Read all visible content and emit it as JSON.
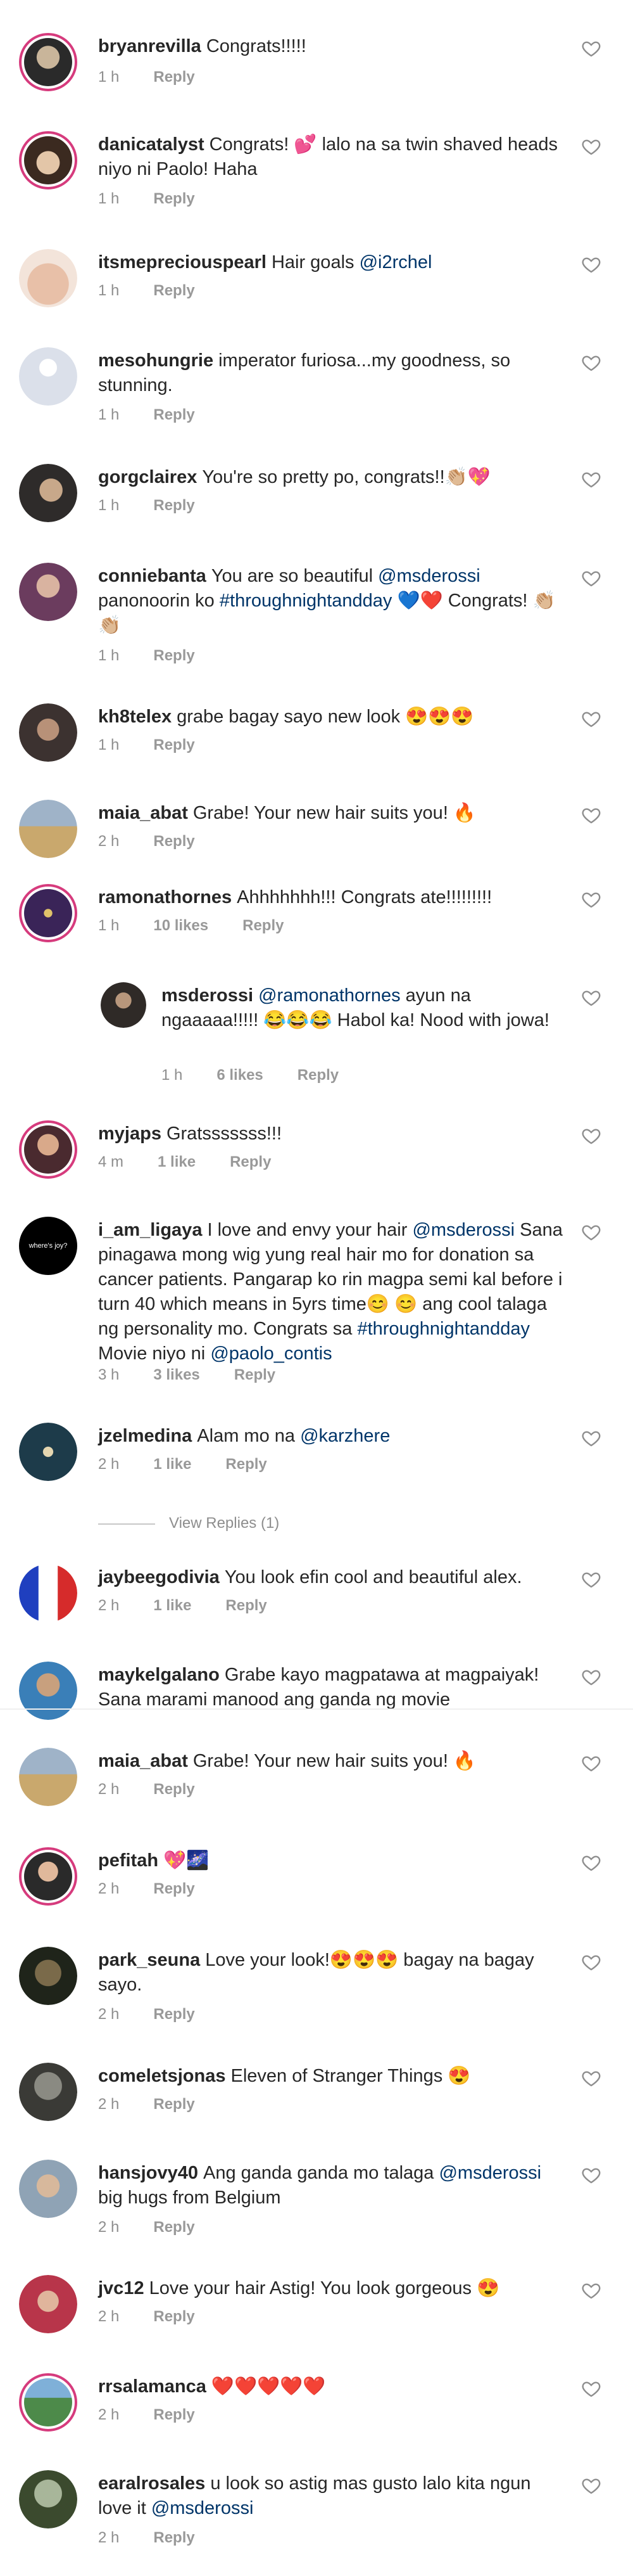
{
  "colors": {
    "link": "#003569",
    "meta": "#8e8e8e",
    "ring": "#d63b7d"
  },
  "comments": [
    {
      "user": "bryanrevilla",
      "text": "Congrats!!!!!",
      "time": "1 h",
      "likes": "",
      "reply": "Reply"
    },
    {
      "user": "danicatalyst",
      "text": "Congrats! 💕 lalo na sa twin shaved heads niyo ni Paolo! Haha",
      "time": "1 h",
      "likes": "",
      "reply": "Reply"
    },
    {
      "user": "itsmepreciouspearl",
      "text": "Hair goals",
      "mention": "@i2rchel",
      "time": "1 h",
      "likes": "",
      "reply": "Reply"
    },
    {
      "user": "mesohungrie",
      "text": "imperator furiosa...my goodness, so stunning.",
      "time": "1 h",
      "likes": "",
      "reply": "Reply"
    },
    {
      "user": "gorgclairex",
      "text": "You're so pretty po, congrats!!👏🏼💖",
      "time": "1 h",
      "likes": "",
      "reply": "Reply"
    },
    {
      "user": "conniebanta",
      "text_a": "You are so beautiful",
      "mention": "@msderossi",
      "text_b": "panonoorin ko",
      "hashtag": "#throughnightandday",
      "text_c": "💙❤️ Congrats! 👏🏼👏🏼",
      "time": "1 h",
      "likes": "",
      "reply": "Reply"
    },
    {
      "user": "kh8telex",
      "text": "grabe bagay sayo new look 😍😍😍",
      "time": "1 h",
      "likes": "",
      "reply": "Reply"
    },
    {
      "user": "maia_abat",
      "text": "Grabe! Your new hair suits you! 🔥",
      "time": "2 h",
      "likes": "",
      "reply": "Reply"
    },
    {
      "user": "ramonathornes",
      "text": "Ahhhhhhh!!! Congrats ate!!!!!!!!!",
      "time": "1 h",
      "likes": "10 likes",
      "reply": "Reply"
    },
    {
      "user": "msderossi",
      "mention": "@ramonathornes",
      "text": "ayun na ngaaaaa!!!!! 😂😂😂 Habol ka! Nood with jowa!",
      "time": "1 h",
      "likes": "6 likes",
      "reply": "Reply"
    },
    {
      "user": "myjaps",
      "text": "Gratsssssss!!!",
      "time": "4 m",
      "likes": "1 like",
      "reply": "Reply"
    },
    {
      "user": "i_am_ligaya",
      "avatar_label": "where's joy?",
      "text_a": "I love and envy your hair",
      "mention": "@msderossi",
      "text_b": "Sana pinagawa mong wig yung real hair mo for donation sa cancer patients. Pangarap ko rin magpa semi kal before i turn 40 which means in 5yrs time😊 😊 ang cool talaga ng personality mo. Congrats sa",
      "hashtag": "#throughnightandday",
      "text_c": "Movie niyo ni",
      "mention2": "@paolo_contis",
      "time": "3 h",
      "likes": "3 likes",
      "reply": "Reply"
    },
    {
      "user": "jzelmedina",
      "text": "Alam mo na",
      "mention": "@karzhere",
      "time": "2 h",
      "likes": "1 like",
      "reply": "Reply"
    },
    {
      "view_replies": "View Replies (1)"
    },
    {
      "user": "jaybeegodivia",
      "text": "You look efin cool and beautiful alex.",
      "time": "2 h",
      "likes": "1 like",
      "reply": "Reply"
    },
    {
      "user": "maykelgalano",
      "text": "Grabe kayo magpatawa at magpaiyak! Sana marami manood ang ganda ng movie",
      "time": "",
      "likes": "",
      "reply": ""
    },
    {
      "user": "maia_abat",
      "text": "Grabe! Your new hair suits you! 🔥",
      "time": "2 h",
      "likes": "",
      "reply": "Reply"
    },
    {
      "user": "pefitah",
      "text": "💖🌌",
      "time": "2 h",
      "likes": "",
      "reply": "Reply"
    },
    {
      "user": "park_seuna",
      "text": "Love your look!😍😍😍 bagay na bagay sayo.",
      "time": "2 h",
      "likes": "",
      "reply": "Reply"
    },
    {
      "user": "comeletsjonas",
      "text": "Eleven of Stranger Things 😍",
      "time": "2 h",
      "likes": "",
      "reply": "Reply"
    },
    {
      "user": "hansjovy40",
      "text_a": "Ang ganda ganda mo talaga",
      "mention": "@msderossi",
      "text_b": "big hugs from Belgium",
      "time": "2 h",
      "likes": "",
      "reply": "Reply"
    },
    {
      "user": "jvc12",
      "text": "Love your hair Astig! You look gorgeous 😍",
      "time": "2 h",
      "likes": "",
      "reply": "Reply"
    },
    {
      "user": "rrsalamanca",
      "text": "❤️❤️❤️❤️❤️",
      "time": "2 h",
      "likes": "",
      "reply": "Reply"
    },
    {
      "user": "earalrosales",
      "text": "u look so astig mas gusto lalo kita ngun love it",
      "mention": "@msderossi",
      "time": "2 h",
      "likes": "",
      "reply": "Reply"
    }
  ]
}
